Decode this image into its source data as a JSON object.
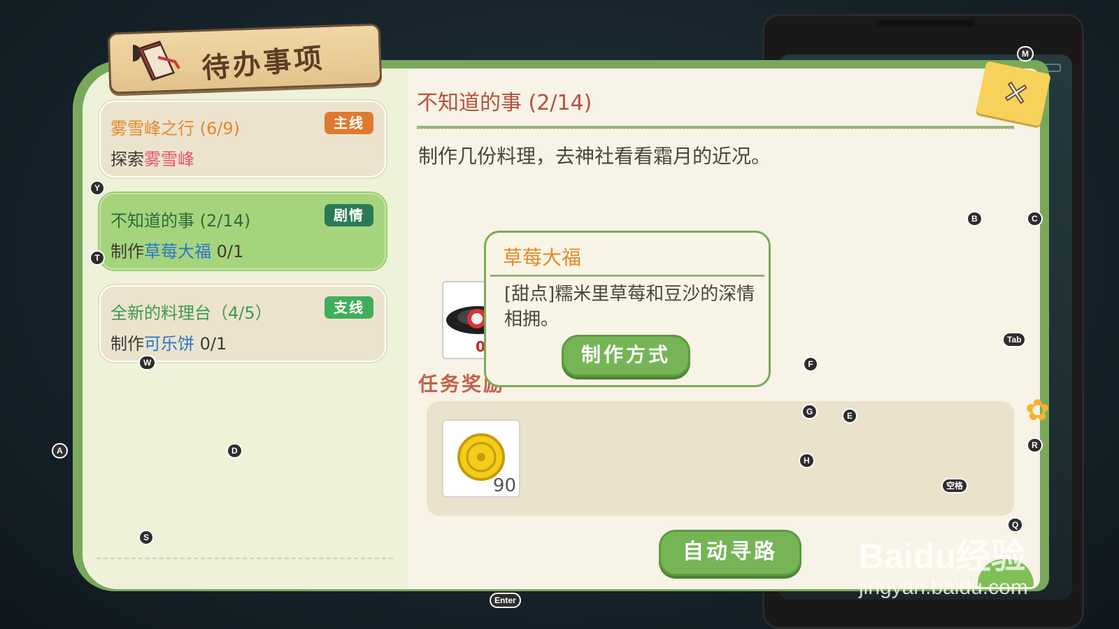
{
  "window": {
    "title": "待办事项"
  },
  "quests": [
    {
      "title": "雾雪峰之行 (6/9)",
      "tag": "主线",
      "desc_prefix": "探索",
      "desc_highlight": "雾雪峰",
      "desc_suffix": "",
      "title_color": "#e38a2c",
      "tag_color": "#e07a2e"
    },
    {
      "title": "不知道的事 (2/14)",
      "tag": "剧情",
      "desc_prefix": "制作",
      "desc_highlight": "草莓大福",
      "desc_suffix": " 0/1",
      "title_color": "#2e6c3b",
      "tag_color": "#2a7a55",
      "selected": true
    },
    {
      "title": "全新的料理台（4/5）",
      "tag": "支线",
      "desc_prefix": "制作",
      "desc_highlight": "可乐饼",
      "desc_suffix": " 0/1",
      "title_color": "#3e9a55",
      "tag_color": "#3fae5a"
    }
  ],
  "detail": {
    "title": "不知道的事 (2/14)",
    "description": "制作几份料理，去神社看看霜月的近况。",
    "item_count": "0",
    "reward_label": "任务奖励",
    "reward_coin_count": "90",
    "auto_path_label": "自动寻路"
  },
  "tooltip": {
    "title": "草莓大福",
    "description": "[甜点]糯米里草莓和豆沙的深情相拥。",
    "recipe_button": "制作方式"
  },
  "close_label": "✕",
  "key_hints": {
    "M": "M",
    "Y": "Y",
    "T": "T",
    "W": "W",
    "A": "A",
    "D": "D",
    "S": "S",
    "B": "B",
    "C": "C",
    "Tab": "Tab",
    "F": "F",
    "G": "G",
    "E": "E",
    "R": "R",
    "H": "H",
    "Space": "空格",
    "Q": "Q",
    "Enter": "Enter"
  },
  "watermark": {
    "logo": "Baidu经验",
    "url": "jingyan.baidu.com"
  },
  "colors": {
    "accent_green": "#76b556",
    "frame_green": "#79a85c",
    "title_red": "#b4523e",
    "highlight_red": "#e8556a",
    "highlight_blue": "#2b76c8"
  }
}
